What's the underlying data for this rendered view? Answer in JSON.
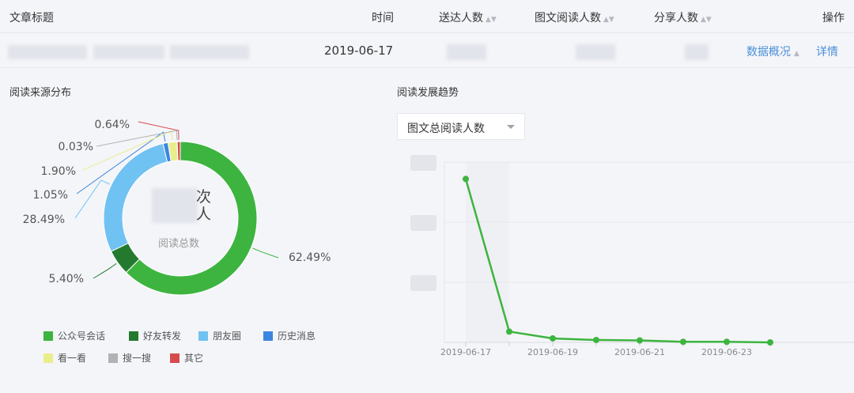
{
  "table": {
    "headers": {
      "title": "文章标题",
      "time": "时间",
      "delivered": "送达人数",
      "reads": "图文阅读人数",
      "shares": "分享人数",
      "actions": "操作"
    },
    "row": {
      "date": "2019-06-17",
      "overview_link": "数据概况",
      "detail_link": "详情"
    }
  },
  "left": {
    "title": "阅读来源分布",
    "center_unit_1": "次",
    "center_unit_2": "人",
    "center_label": "阅读总数"
  },
  "right": {
    "title": "阅读发展趋势",
    "select_value": "图文总阅读人数"
  },
  "chart_data": [
    {
      "type": "pie",
      "title": "阅读来源分布",
      "donut": true,
      "slices": [
        {
          "name": "公众号会话",
          "value": 62.49,
          "label": "62.49%",
          "color": "#3db43f"
        },
        {
          "name": "好友转发",
          "value": 5.4,
          "label": "5.40%",
          "color": "#237a2f"
        },
        {
          "name": "朋友圈",
          "value": 28.49,
          "label": "28.49%",
          "color": "#70c2f2"
        },
        {
          "name": "历史消息",
          "value": 1.05,
          "label": "1.05%",
          "color": "#3c86e0"
        },
        {
          "name": "看一看",
          "value": 1.9,
          "label": "1.90%",
          "color": "#e9ee8c"
        },
        {
          "name": "搜一搜",
          "value": 0.03,
          "label": "0.03%",
          "color": "#b2b2b2"
        },
        {
          "name": "其它",
          "value": 0.64,
          "label": "0.64%",
          "color": "#d64c4c"
        }
      ]
    },
    {
      "type": "line",
      "title": "阅读发展趋势",
      "series_name": "图文总阅读人数",
      "color": "#3db43f",
      "x": [
        "2019-06-17",
        "2019-06-18",
        "2019-06-19",
        "2019-06-20",
        "2019-06-21",
        "2019-06-22",
        "2019-06-23",
        "2019-06-24"
      ],
      "x_tick_labels": [
        "2019-06-17",
        "2019-06-19",
        "2019-06-21",
        "2019-06-23"
      ],
      "values_relative": [
        2.72,
        0.18,
        0.066,
        0.04,
        0.033,
        0.01,
        0.01,
        0.0
      ],
      "ylim_relative": [
        0,
        3
      ],
      "grid": true,
      "y_tick_labels_hidden": true
    }
  ]
}
